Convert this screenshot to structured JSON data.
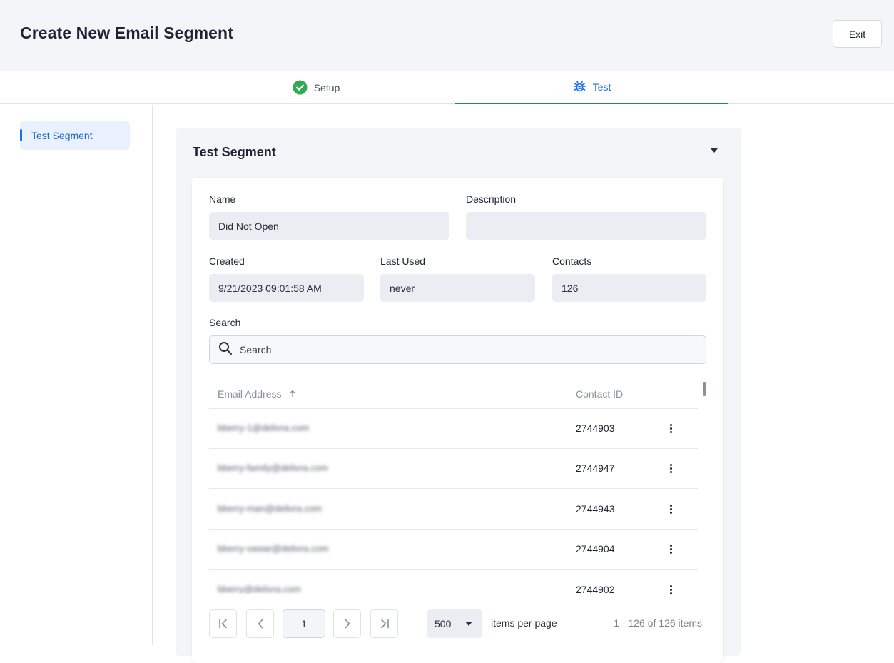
{
  "header": {
    "title": "Create New Email Segment",
    "exit_label": "Exit"
  },
  "steps": [
    {
      "label": "Setup",
      "icon": "check-circle-icon",
      "status": "complete",
      "color": "#34a853"
    },
    {
      "label": "Test",
      "icon": "bug-icon",
      "status": "active",
      "color": "#1a73e8"
    }
  ],
  "sidebar": {
    "items": [
      {
        "label": "Test Segment",
        "active": true
      }
    ]
  },
  "panel": {
    "title": "Test Segment",
    "fields": {
      "name": {
        "label": "Name",
        "value": "Did Not Open"
      },
      "description": {
        "label": "Description",
        "value": ""
      },
      "created": {
        "label": "Created",
        "value": "9/21/2023 09:01:58 AM"
      },
      "last_used": {
        "label": "Last Used",
        "value": "never"
      },
      "contacts": {
        "label": "Contacts",
        "value": "126"
      }
    },
    "search": {
      "label": "Search",
      "placeholder": "Search"
    },
    "table": {
      "columns": [
        "Email Address",
        "Contact ID"
      ],
      "sort": {
        "column": "Email Address",
        "direction": "ascending"
      },
      "rows": [
        {
          "email": "bberry-1@delivra.com",
          "contact_id": "2744903"
        },
        {
          "email": "bberry-family@delivra.com",
          "contact_id": "2744947"
        },
        {
          "email": "bberry-man@delivra.com",
          "contact_id": "2744943"
        },
        {
          "email": "bberry-vasiar@delivra.com",
          "contact_id": "2744904"
        },
        {
          "email": "bberry@delivra.com",
          "contact_id": "2744902"
        }
      ]
    },
    "pagination": {
      "current_page": "1",
      "page_size": "500",
      "page_size_label": "items per page",
      "info": "1 - 126 of 126 items"
    }
  },
  "colors": {
    "accent": "#1a73e8",
    "success": "#34a853",
    "header_bg": "#f4f5f8"
  }
}
